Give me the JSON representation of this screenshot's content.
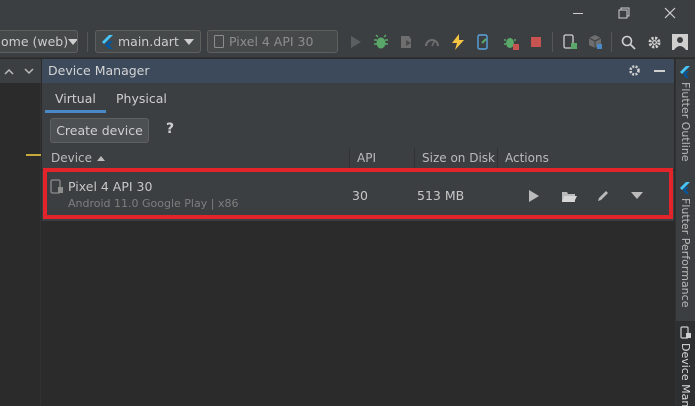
{
  "toolbar": {
    "browser_combo": "ome (web)",
    "target_combo": "main.dart",
    "device_combo": "Pixel 4 API 30"
  },
  "panel": {
    "title": "Device Manager",
    "tabs": [
      {
        "label": "Virtual",
        "active": true
      },
      {
        "label": "Physical",
        "active": false
      }
    ],
    "create_button": "Create device",
    "help": "?"
  },
  "table": {
    "columns": [
      "Device",
      "API",
      "Size on Disk",
      "Actions"
    ],
    "sort_column": "Device",
    "rows": [
      {
        "name": "Pixel 4 API 30",
        "details": "Android 11.0 Google Play | x86",
        "api": "30",
        "size": "513 MB"
      }
    ]
  },
  "right_tools": [
    {
      "label": "Flutter Outline",
      "icon": "flutter-icon"
    },
    {
      "label": "Flutter Performance",
      "icon": "flutter-icon"
    },
    {
      "label": "Device Mana",
      "icon": "device-manager-icon"
    }
  ],
  "colors": {
    "accent_tab": "#4a88c7",
    "highlight_box": "#e3252b",
    "panel_header": "#3c4a5c"
  }
}
